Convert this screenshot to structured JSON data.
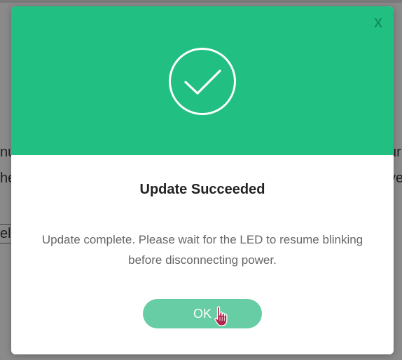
{
  "background": {
    "left_fragment_1": "nu",
    "left_fragment_2": "he",
    "right_fragment_1": "ur",
    "right_fragment_2": "ve",
    "field_fragment": "el"
  },
  "dialog": {
    "close_label": "X",
    "header_color": "#21bf81",
    "success_icon": "checkmark-circle-icon",
    "title": "Update Succeeded",
    "message": "Update complete. Please wait for the LED to resume blinking before disconnecting power.",
    "ok_label": "OK"
  }
}
